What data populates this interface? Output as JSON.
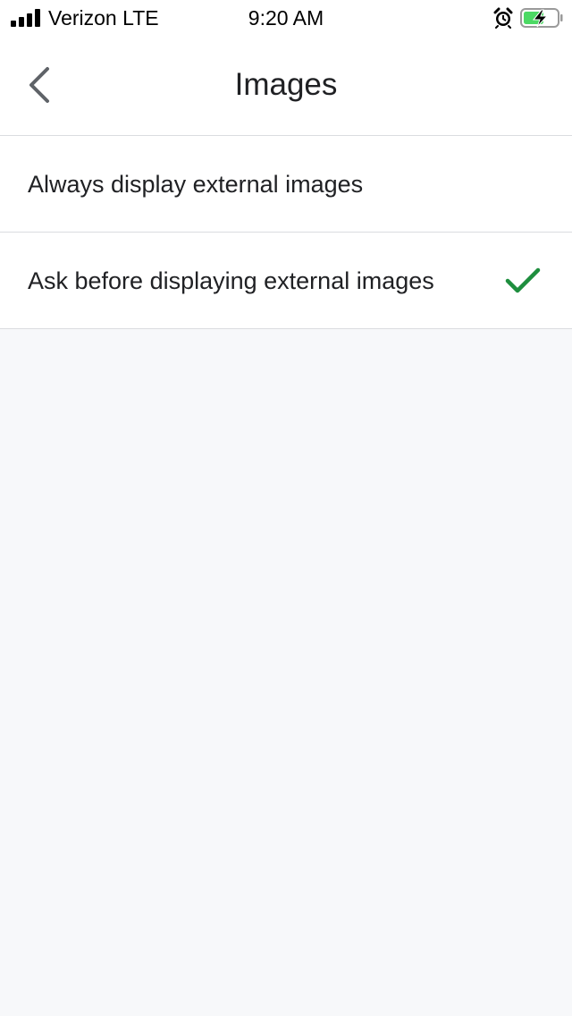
{
  "status_bar": {
    "carrier": "Verizon LTE",
    "time": "9:20 AM",
    "icons": [
      "signal-icon",
      "alarm-icon",
      "battery-charging-icon"
    ],
    "battery_color": "#4cd964"
  },
  "header": {
    "title": "Images",
    "back_icon": "chevron-left-icon"
  },
  "options": [
    {
      "label": "Always display external images",
      "selected": false
    },
    {
      "label": "Ask before displaying external images",
      "selected": true
    }
  ],
  "colors": {
    "accent_check": "#1e8e3e",
    "background": "#f7f8fa",
    "divider": "#dadce0"
  }
}
